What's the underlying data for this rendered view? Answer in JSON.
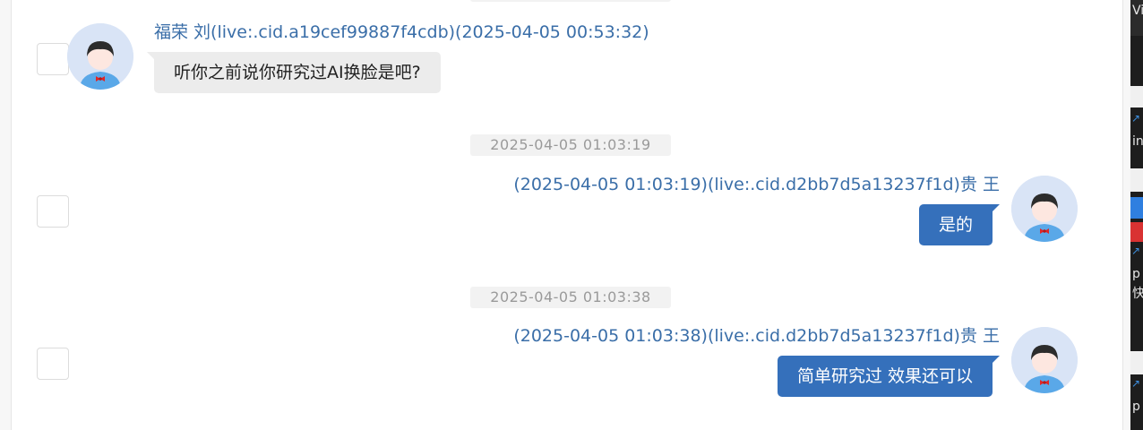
{
  "messages": [
    {
      "direction": "incoming",
      "sender": "福荣 刘(live:.cid.a19cef99887f4cdb)(2025-04-05 00:53:32)",
      "text": "听你之前说你研究过AI换脸是吧?"
    },
    {
      "direction": "outgoing",
      "divider_time": "2025-04-05 01:03:19",
      "sender": "(2025-04-05 01:03:19)(live:.cid.d2bb7d5a13237f1d)贵 王",
      "text": "是的"
    },
    {
      "direction": "outgoing",
      "divider_time": "2025-04-05 01:03:38",
      "sender": "(2025-04-05 01:03:38)(live:.cid.d2bb7d5a13237f1d)贵 王",
      "text": "简单研究过 效果还可以"
    }
  ],
  "side_strip": {
    "fragments": [
      "Vir",
      "in",
      "p",
      "快",
      "p"
    ],
    "link_icon": "external-link-icon"
  },
  "colors": {
    "accent": "#3570bb",
    "sender_text": "#3a6ea8",
    "incoming_bubble": "#ececec",
    "timestamp_bg": "#f2f2f2",
    "avatar_bg": "#d9e4f6"
  }
}
